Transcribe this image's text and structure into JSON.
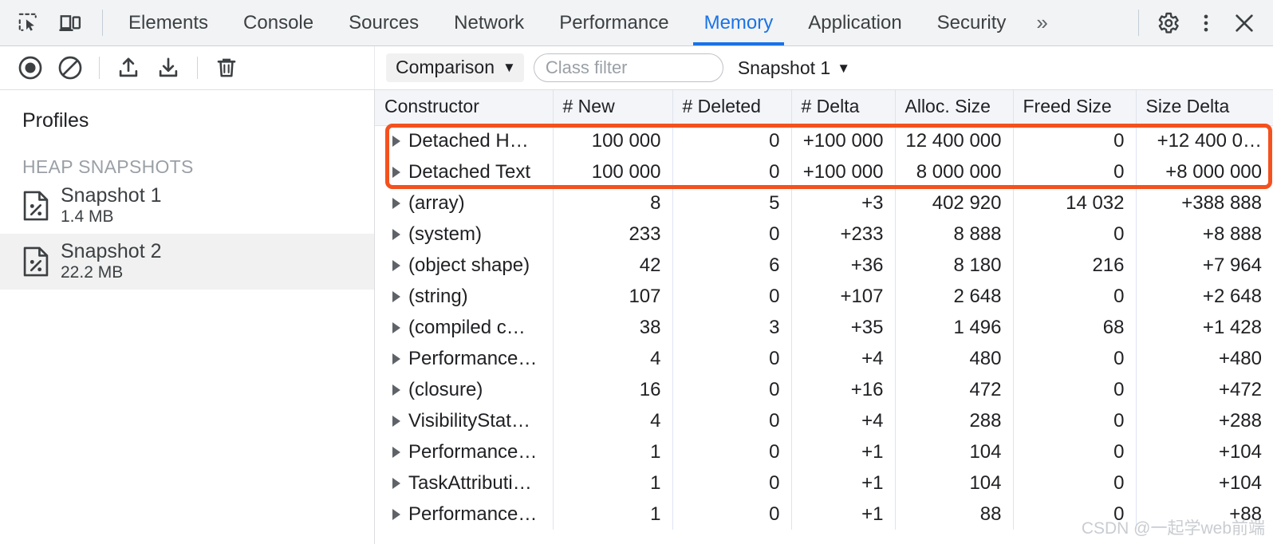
{
  "tabbar": {
    "inspect_icon": "inspect-element-icon",
    "device_icon": "device-toolbar-icon",
    "tabs": [
      {
        "label": "Elements",
        "active": false
      },
      {
        "label": "Console",
        "active": false
      },
      {
        "label": "Sources",
        "active": false
      },
      {
        "label": "Network",
        "active": false
      },
      {
        "label": "Performance",
        "active": false
      },
      {
        "label": "Memory",
        "active": true
      },
      {
        "label": "Application",
        "active": false
      },
      {
        "label": "Security",
        "active": false
      }
    ],
    "more_tabs_label": "»",
    "settings_icon": "gear-icon",
    "menu_icon": "kebab-menu-icon",
    "close_icon": "close-icon",
    "accent_color": "#1a73e8"
  },
  "toolbar": {
    "record_icon": "record-icon",
    "clear_icon": "clear-icon",
    "load_icon": "upload-icon",
    "save_icon": "download-icon",
    "delete_icon": "trash-icon",
    "view_select": "Comparison",
    "class_filter_placeholder": "Class filter",
    "class_filter_value": "",
    "baseline_select": "Snapshot 1",
    "caret_glyph": "▼"
  },
  "sidebar": {
    "title": "Profiles",
    "section_label": "HEAP SNAPSHOTS",
    "snapshots": [
      {
        "name": "Snapshot 1",
        "size": "1.4 MB",
        "selected": false,
        "icon": "heap-snapshot-icon"
      },
      {
        "name": "Snapshot 2",
        "size": "22.2 MB",
        "selected": true,
        "icon": "heap-snapshot-icon"
      }
    ]
  },
  "table": {
    "columns": [
      "Constructor",
      "# New",
      "# Deleted",
      "# Delta",
      "Alloc. Size",
      "Freed Size",
      "Size Delta"
    ],
    "rows": [
      {
        "constructor": "Detached H…",
        "new": "100 000",
        "deleted": "0",
        "delta": "+100 000",
        "alloc": "12 400 000",
        "freed": "0",
        "size_delta": "+12 400 0…",
        "highlighted": true
      },
      {
        "constructor": "Detached Text",
        "new": "100 000",
        "deleted": "0",
        "delta": "+100 000",
        "alloc": "8 000 000",
        "freed": "0",
        "size_delta": "+8 000 000",
        "highlighted": true
      },
      {
        "constructor": "(array)",
        "new": "8",
        "deleted": "5",
        "delta": "+3",
        "alloc": "402 920",
        "freed": "14 032",
        "size_delta": "+388 888",
        "highlighted": false
      },
      {
        "constructor": "(system)",
        "new": "233",
        "deleted": "0",
        "delta": "+233",
        "alloc": "8 888",
        "freed": "0",
        "size_delta": "+8 888",
        "highlighted": false
      },
      {
        "constructor": "(object shape)",
        "new": "42",
        "deleted": "6",
        "delta": "+36",
        "alloc": "8 180",
        "freed": "216",
        "size_delta": "+7 964",
        "highlighted": false
      },
      {
        "constructor": "(string)",
        "new": "107",
        "deleted": "0",
        "delta": "+107",
        "alloc": "2 648",
        "freed": "0",
        "size_delta": "+2 648",
        "highlighted": false
      },
      {
        "constructor": "(compiled c…",
        "new": "38",
        "deleted": "3",
        "delta": "+35",
        "alloc": "1 496",
        "freed": "68",
        "size_delta": "+1 428",
        "highlighted": false
      },
      {
        "constructor": "Performance…",
        "new": "4",
        "deleted": "0",
        "delta": "+4",
        "alloc": "480",
        "freed": "0",
        "size_delta": "+480",
        "highlighted": false
      },
      {
        "constructor": "(closure)",
        "new": "16",
        "deleted": "0",
        "delta": "+16",
        "alloc": "472",
        "freed": "0",
        "size_delta": "+472",
        "highlighted": false
      },
      {
        "constructor": "VisibilityStat…",
        "new": "4",
        "deleted": "0",
        "delta": "+4",
        "alloc": "288",
        "freed": "0",
        "size_delta": "+288",
        "highlighted": false
      },
      {
        "constructor": "Performance…",
        "new": "1",
        "deleted": "0",
        "delta": "+1",
        "alloc": "104",
        "freed": "0",
        "size_delta": "+104",
        "highlighted": false
      },
      {
        "constructor": "TaskAttributi…",
        "new": "1",
        "deleted": "0",
        "delta": "+1",
        "alloc": "104",
        "freed": "0",
        "size_delta": "+104",
        "highlighted": false
      },
      {
        "constructor": "Performance…",
        "new": "1",
        "deleted": "0",
        "delta": "+1",
        "alloc": "88",
        "freed": "0",
        "size_delta": "+88",
        "highlighted": false
      }
    ],
    "highlight_color": "#f4511e",
    "expand_glyph": "▶"
  },
  "watermark": {
    "text": "CSDN @一起学web前端"
  }
}
